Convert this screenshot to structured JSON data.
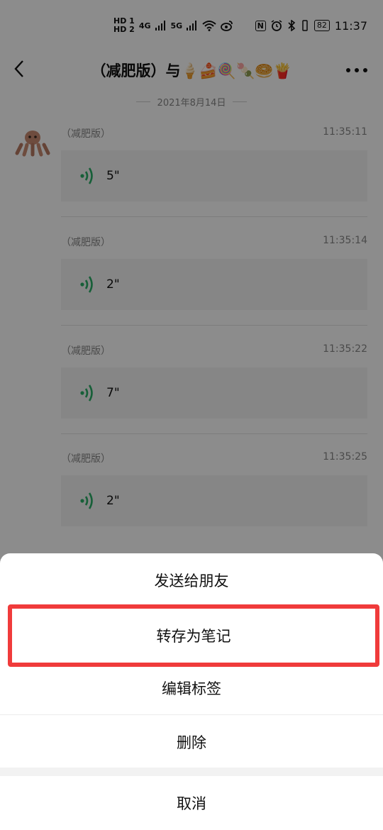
{
  "status_bar": {
    "hd1": "HD 1",
    "hd2": "HD 2",
    "network1": "4G",
    "network2": "5G",
    "nfc": "N",
    "battery": "82",
    "time": "11:37"
  },
  "header": {
    "title": "（减肥版）与🍦🍰🍭🍡🥯🍟"
  },
  "date_separator": "2021年8月14日",
  "messages": [
    {
      "sender": "（减肥版）",
      "time": "11:35:11",
      "duration": "5\""
    },
    {
      "sender": "（减肥版）",
      "time": "11:35:14",
      "duration": "2\""
    },
    {
      "sender": "（减肥版）",
      "time": "11:35:22",
      "duration": "7\""
    },
    {
      "sender": "（减肥版）",
      "time": "11:35:25",
      "duration": "2\""
    }
  ],
  "action_sheet": {
    "items": [
      {
        "label": "发送给朋友"
      },
      {
        "label": "转存为笔记"
      },
      {
        "label": "编辑标签"
      },
      {
        "label": "删除"
      }
    ],
    "cancel": "取消"
  },
  "colors": {
    "voice_icon": "#2aae67",
    "highlight_border": "#f03b3b"
  }
}
